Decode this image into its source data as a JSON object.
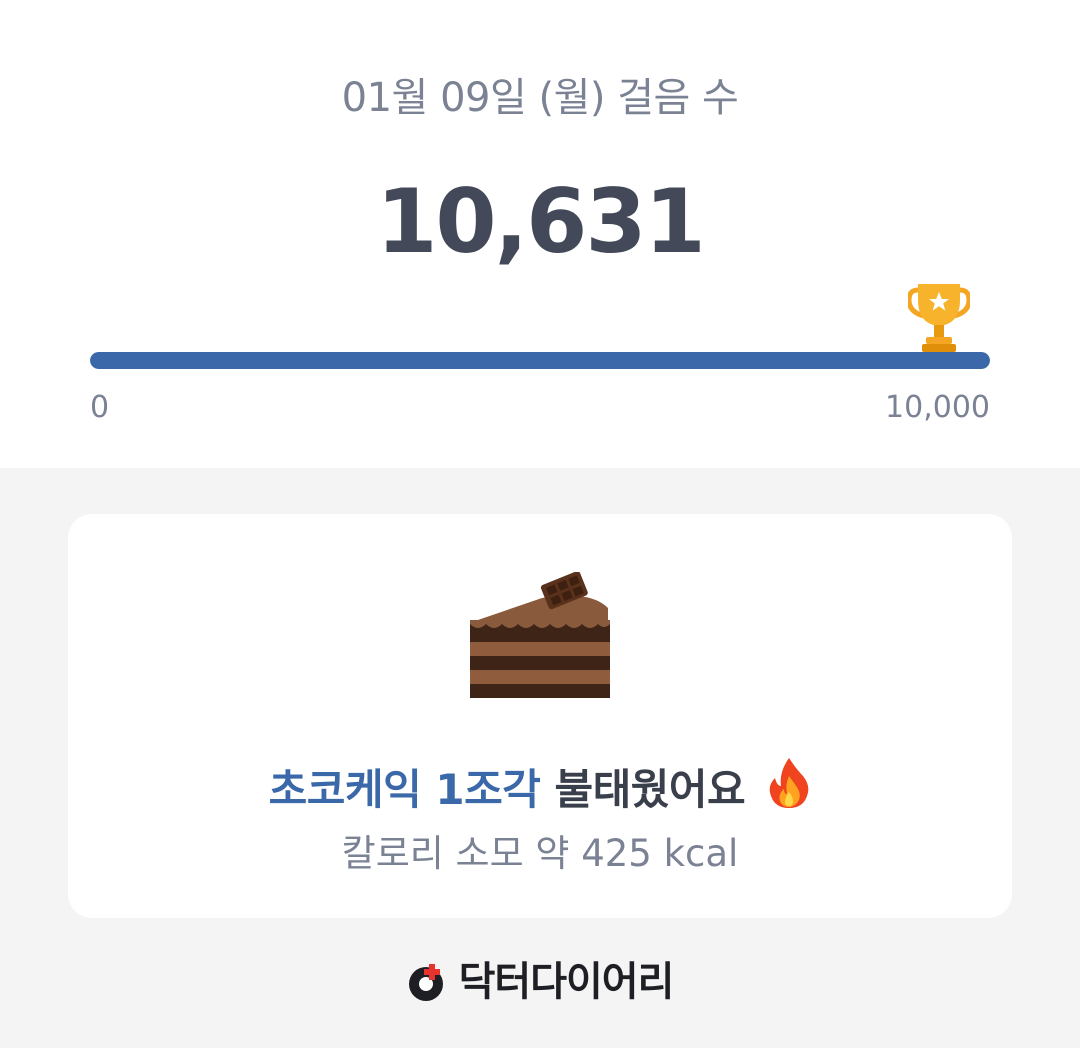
{
  "header": {
    "date_title": "01월 09일 (월) 걸음 수",
    "steps": "10,631"
  },
  "progress": {
    "min_label": "0",
    "max_label": "10,000",
    "value": 10631,
    "goal": 10000,
    "fill_fraction": 1.0,
    "goal_icon": "trophy-icon",
    "color": "#3b68a9"
  },
  "calorie_card": {
    "icon": "chocolate-cake-icon",
    "food": "초코케익 1조각",
    "burned_text": "불태웠어요",
    "burned_icon": "fire-icon",
    "calorie_text": "칼로리 소모 약 425 kcal"
  },
  "brand": {
    "logo_icon": "doctor-diary-logo-icon",
    "name": "닥터다이어리"
  },
  "colors": {
    "accent": "#3b68a9",
    "text_dark": "#434958",
    "text_muted": "#7a8294",
    "background": "#f4f4f4"
  }
}
